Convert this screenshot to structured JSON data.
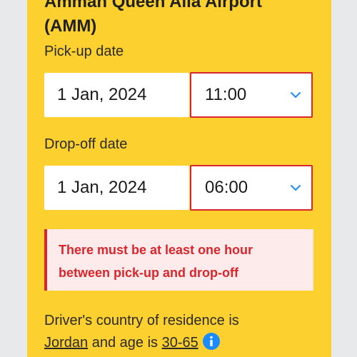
{
  "location": {
    "title_line1": "Amman Queen Alia Airport",
    "title_line2": "(AMM)"
  },
  "pickup": {
    "label": "Pick-up date",
    "date": "1 Jan, 2024",
    "time": "11:00"
  },
  "dropoff": {
    "label": "Drop-off date",
    "date": "1 Jan, 2024",
    "time": "06:00"
  },
  "error": {
    "line1": "There must be at least one hour",
    "line2": "between pick-up and drop-off"
  },
  "driver": {
    "prefix": "Driver's country of residence is",
    "country": "Jordan",
    "middle": " and age is ",
    "age": "30-65"
  },
  "icons": {
    "time_dropdown": "chevron-down-icon",
    "info": "info-icon"
  },
  "colors": {
    "panel": "#fcd12f",
    "error": "#d9262c",
    "error_bg": "#fdebeb",
    "info": "#1a8cff"
  }
}
